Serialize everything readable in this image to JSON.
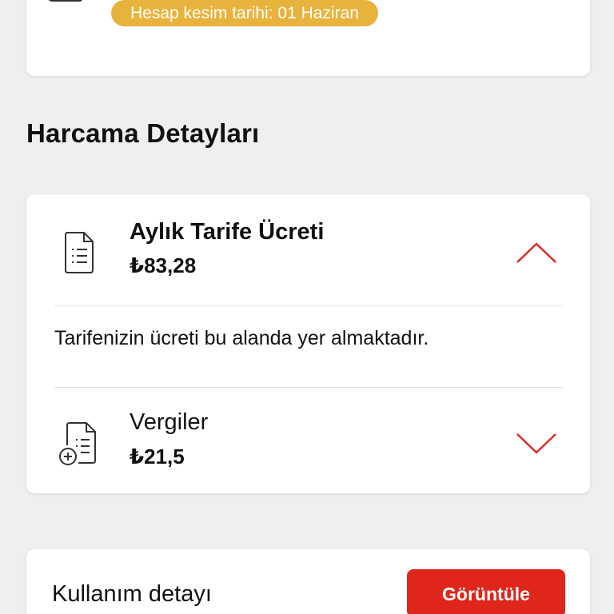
{
  "billing_card": {
    "badge_text": "Hesap kesim tarihi: 01 Haziran",
    "badge_color": "#e8b33c",
    "icon": "document-icon"
  },
  "section": {
    "title": "Harcama Detayları"
  },
  "spending": {
    "items": [
      {
        "title": "Aylık Tarife Ücreti",
        "amount": "₺83,28",
        "icon": "document-list-icon",
        "expanded": true,
        "description": "Tarifenizin ücreti bu alanda yer almaktadır."
      },
      {
        "title": "Vergiler",
        "amount": "₺21,5",
        "icon": "document-plus-icon",
        "expanded": false
      }
    ]
  },
  "usage": {
    "label": "Kullanım detayı",
    "button_label": "Görüntüle",
    "button_color": "#e0251b"
  },
  "accent_color": "#e0251b"
}
